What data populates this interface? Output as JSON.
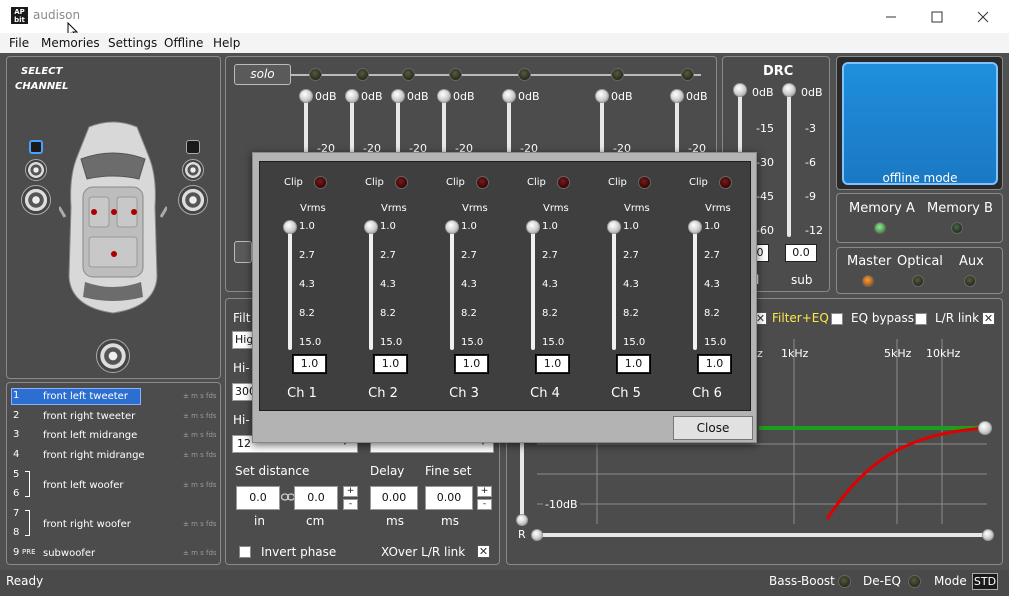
{
  "window": {
    "title": "audison",
    "logo_text": "AP bit"
  },
  "menu": [
    "File",
    "Memories",
    "Settings",
    "Offline",
    "Help"
  ],
  "select_channel": {
    "label_line1": "SELECT",
    "label_line2": "CHANNEL"
  },
  "channels": [
    {
      "num": "1",
      "label": "front left tweeter",
      "selected": true
    },
    {
      "num": "2",
      "label": "front right tweeter"
    },
    {
      "num": "3",
      "label": "front left midrange"
    },
    {
      "num": "4",
      "label": "front right midrange"
    },
    {
      "num": "5",
      "label": "front left woofer",
      "num2": "6"
    },
    {
      "num": "7",
      "label": "front right woofer",
      "num2": "8"
    },
    {
      "num": "9",
      "label": "subwoofer",
      "pre": "PRE"
    }
  ],
  "channel_flags": "± m s fds",
  "solo_label": "solo",
  "mixer_ticks": {
    "top": "0dB",
    "second": "-20"
  },
  "drc": {
    "title": "DRC",
    "left_ticks": [
      "0dB",
      "-15",
      "-30",
      "-45",
      "-60"
    ],
    "right_ticks": [
      "0dB",
      "-3",
      "-6",
      "-9",
      "-12"
    ],
    "left_value": "0",
    "right_value": "0.0",
    "left_caption": "l",
    "right_caption": "sub"
  },
  "offline_mode_label": "offline mode",
  "memory": {
    "a": "Memory A",
    "b": "Memory B"
  },
  "inputs": {
    "master": "Master",
    "optical": "Optical",
    "aux": "Aux"
  },
  "filter_panel": {
    "filter_label": "Filt",
    "type_value": "Hig",
    "hi_label_1": "Hi-",
    "freq_value": "300",
    "hi_label_2": "Hi-",
    "slope_value": "12",
    "set_distance": "Set distance",
    "delay": "Delay",
    "fine_set": "Fine set",
    "distance_in": "0.0",
    "distance_cm": "0.0",
    "delay_ms": "0.00",
    "fine_ms": "0.00",
    "unit_in": "in",
    "unit_cm": "cm",
    "unit_ms1": "ms",
    "unit_ms2": "ms",
    "invert_phase": "Invert phase",
    "xover_link": "XOver L/R link"
  },
  "eq_panel": {
    "filter_eq": "Filter+EQ",
    "eq_bypass": "EQ bypass",
    "lr_link": "L/R link",
    "freq_labels": [
      "1kHz",
      "5kHz",
      "10kHz"
    ],
    "freq_label_partial": "z",
    "db_label": "-10dB",
    "r_label": "R"
  },
  "status": {
    "text": "Ready",
    "bass_boost": "Bass-Boost",
    "de_eq": "De-EQ",
    "mode": "Mode",
    "mode_value": "STD"
  },
  "modal": {
    "clip_label": "Clip",
    "vrms_label": "Vrms",
    "ticks": [
      "1.0",
      "2.7",
      "4.3",
      "8.2",
      "15.0"
    ],
    "channels": [
      {
        "name": "Ch 1",
        "value": "1.0"
      },
      {
        "name": "Ch 2",
        "value": "1.0"
      },
      {
        "name": "Ch 3",
        "value": "1.0"
      },
      {
        "name": "Ch 4",
        "value": "1.0"
      },
      {
        "name": "Ch 5",
        "value": "1.0"
      },
      {
        "name": "Ch 6",
        "value": "1.0"
      }
    ],
    "close_label": "Close"
  }
}
